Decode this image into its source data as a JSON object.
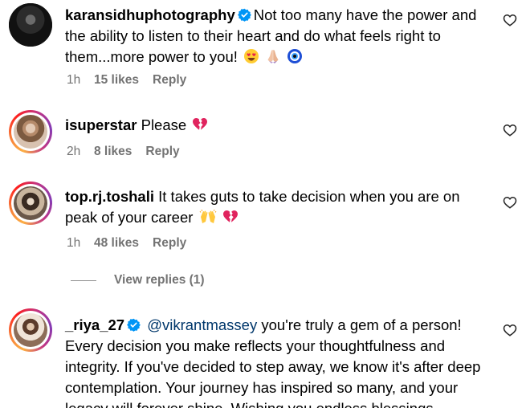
{
  "comments": [
    {
      "username": "karansidhuphotography",
      "verified": true,
      "text": "Not too many have the power and the ability to listen to their heart and do what feels right to them...more power to you!",
      "emojis": [
        "smiling-face-with-heart-eyes",
        "folded-hands",
        "nazar-amulet"
      ],
      "time": "1h",
      "likes": "15 likes",
      "reply_label": "Reply"
    },
    {
      "username": "isuperstar",
      "verified": false,
      "text": "Please",
      "emojis": [
        "broken-heart"
      ],
      "time": "2h",
      "likes": "8 likes",
      "reply_label": "Reply"
    },
    {
      "username": "top.rj.toshali",
      "verified": false,
      "text": "It takes guts to take decision when you are on peak of your career",
      "emojis": [
        "raising-hands",
        "broken-heart"
      ],
      "time": "1h",
      "likes": "48 likes",
      "reply_label": "Reply"
    },
    {
      "username": "_riya_27",
      "verified": true,
      "mention": "@vikrantmassey",
      "text": "you're truly a gem of a person! Every decision you make reflects your thoughtfulness and integrity. If you've decided to step away, we know it's after deep contemplation. Your journey has inspired so many, and your legacy will forever shine. Wishing you endless blessings"
    }
  ],
  "view_replies_label": "View replies (1)",
  "colors": {
    "verified_badge": "#0095f6",
    "mention": "#00376b",
    "meta_text": "#737373",
    "broken_heart": "#e0245e"
  },
  "icons": {
    "like": "heart-outline-icon",
    "verified": "verified-badge-icon"
  }
}
